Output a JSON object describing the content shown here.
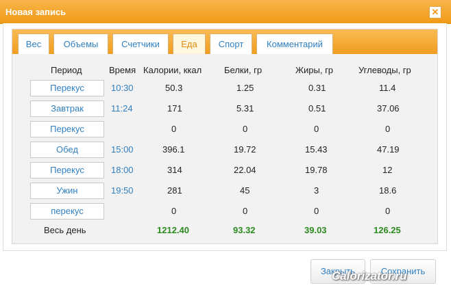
{
  "window": {
    "title": "Новая запись",
    "close_glyph": "✕"
  },
  "tabs": [
    {
      "label": "Вес",
      "active": false
    },
    {
      "label": "Объемы",
      "active": false
    },
    {
      "label": "Счетчики",
      "active": false
    },
    {
      "label": "Еда",
      "active": true
    },
    {
      "label": "Спорт",
      "active": false
    },
    {
      "label": "Комментарий",
      "active": false
    }
  ],
  "table": {
    "headers": {
      "period": "Период",
      "time": "Время",
      "calories": "Калории, ккал",
      "protein": "Белки, гр",
      "fat": "Жиры, гр",
      "carbs": "Углеводы, гр"
    },
    "rows": [
      {
        "period": "Перекус",
        "time": "10:30",
        "calories": "50.3",
        "protein": "1.25",
        "fat": "0.31",
        "carbs": "11.4"
      },
      {
        "period": "Завтрак",
        "time": "11:24",
        "calories": "171",
        "protein": "5.31",
        "fat": "0.51",
        "carbs": "37.06"
      },
      {
        "period": "Перекус",
        "time": "",
        "calories": "0",
        "protein": "0",
        "fat": "0",
        "carbs": "0"
      },
      {
        "period": "Обед",
        "time": "15:00",
        "calories": "396.1",
        "protein": "19.72",
        "fat": "15.43",
        "carbs": "47.19"
      },
      {
        "period": "Перекус",
        "time": "18:00",
        "calories": "314",
        "protein": "22.04",
        "fat": "19.78",
        "carbs": "12"
      },
      {
        "period": "Ужин",
        "time": "19:50",
        "calories": "281",
        "protein": "45",
        "fat": "3",
        "carbs": "18.6"
      },
      {
        "period": "перекус",
        "time": "",
        "calories": "0",
        "protein": "0",
        "fat": "0",
        "carbs": "0"
      }
    ],
    "totals": {
      "label": "Весь день",
      "calories": "1212.40",
      "protein": "93.32",
      "fat": "39.03",
      "carbs": "126.25"
    }
  },
  "footer": {
    "close_label": "Закрыть",
    "save_label": "Сохранить"
  },
  "watermark": "Calorizator.ru",
  "colors": {
    "accent": "#f09a16",
    "link": "#2f7fc1",
    "totals": "#2b8a1e"
  }
}
